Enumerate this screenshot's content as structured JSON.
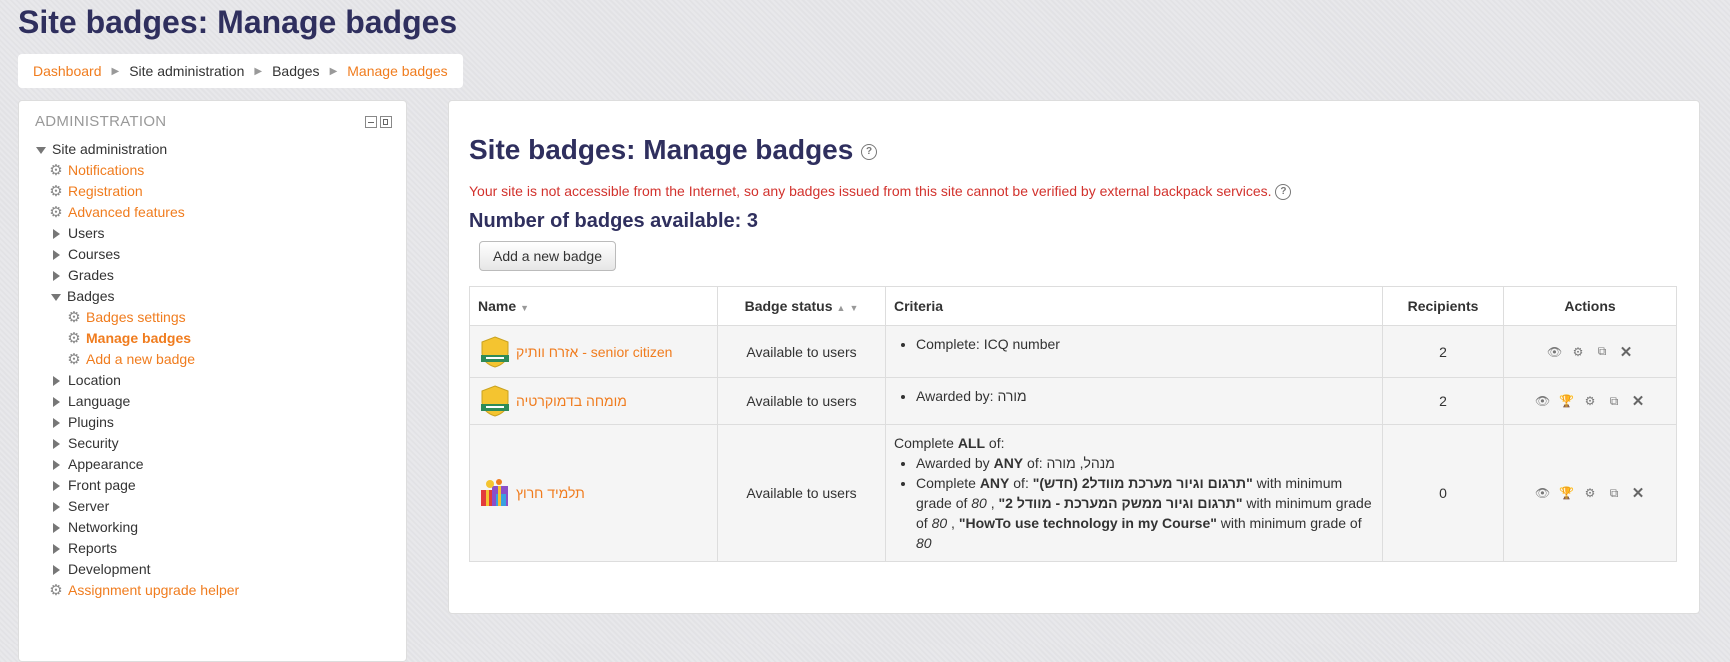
{
  "page_title": "Site badges: Manage badges",
  "breadcrumb": [
    {
      "label": "Dashboard",
      "link": true
    },
    {
      "label": "Site administration",
      "link": false
    },
    {
      "label": "Badges",
      "link": false
    },
    {
      "label": "Manage badges",
      "link": true
    }
  ],
  "admin_block": {
    "header": "ADMINISTRATION",
    "items": {
      "site_admin": "Site administration",
      "notifications": "Notifications",
      "registration": "Registration",
      "advanced": "Advanced features",
      "users": "Users",
      "courses": "Courses",
      "grades": "Grades",
      "badges": "Badges",
      "badges_settings": "Badges settings",
      "manage_badges": "Manage badges",
      "add_new_badge": "Add a new badge",
      "location": "Location",
      "language": "Language",
      "plugins": "Plugins",
      "security": "Security",
      "appearance": "Appearance",
      "front_page": "Front page",
      "server": "Server",
      "networking": "Networking",
      "reports": "Reports",
      "development": "Development",
      "assignment_helper": "Assignment upgrade helper"
    }
  },
  "main": {
    "heading": "Site badges: Manage badges",
    "notice": "Your site is not accessible from the Internet, so any badges issued from this site cannot be verified by external backpack services.",
    "count": "Number of badges available: 3",
    "add_button": "Add a new badge",
    "columns": {
      "name": "Name",
      "status": "Badge status",
      "criteria": "Criteria",
      "recipients": "Recipients",
      "actions": "Actions"
    },
    "rows": [
      {
        "name": "אזרח וותיק - senior citizen",
        "status": "Available to users",
        "criteria_item": "Complete: ICQ number",
        "recipients": "2"
      },
      {
        "name": "מומחה בדמוקרטיה",
        "status": "Available to users",
        "criteria_item": "Awarded by: מורה",
        "recipients": "2"
      },
      {
        "name": "תלמיד חרוץ",
        "status": "Available to users",
        "criteria": {
          "intro_pre": "Complete ",
          "intro_strong": "ALL",
          "intro_post": " of:",
          "c1_pre": "Awarded by ",
          "c1_strong": "ANY",
          "c1_post": " of: מנהל, מורה",
          "c2_pre": "Complete ",
          "c2_strong": "ANY",
          "c2_post": " of: ",
          "course1": "\"תרגום וגיור מערכת מוודל2 (חדש)\"",
          "course2": "\"תרגום וגיור ממשק המערכת - מוודל 2\"",
          "course3": "\"HowTo use technology in my Course\"",
          "with_min": " with minimum grade of ",
          "grade": "80",
          "comma": " , "
        },
        "recipients": "0"
      }
    ]
  },
  "colors": {
    "link": "#f07c1e",
    "heading": "#2f2f5e",
    "warning": "#d2322d"
  }
}
